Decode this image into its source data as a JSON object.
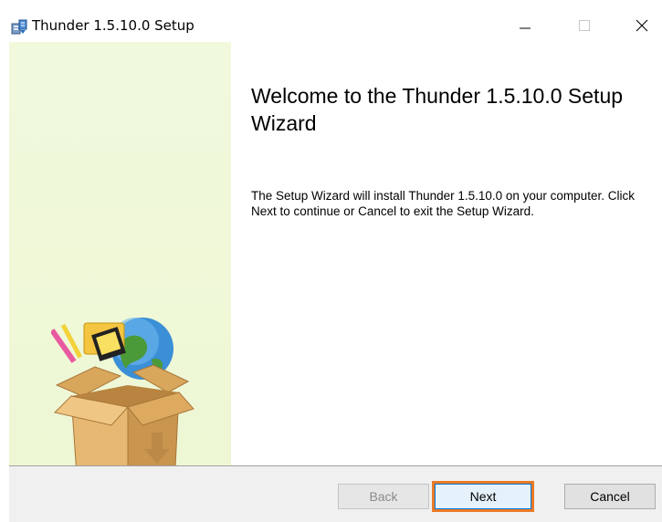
{
  "window": {
    "title": "Thunder 1.5.10.0 Setup",
    "icon": "installer-icon"
  },
  "controls": {
    "minimize_icon": "minimize-icon",
    "maximize_icon": "maximize-icon",
    "close_icon": "close-icon"
  },
  "content": {
    "heading": "Welcome to the Thunder 1.5.10.0 Setup Wizard",
    "description": "The Setup Wizard will install Thunder 1.5.10.0 on your computer. Click Next to continue or Cancel to exit the Setup Wizard."
  },
  "buttons": {
    "back": "Back",
    "next": "Next",
    "cancel": "Cancel"
  },
  "colors": {
    "banner": "#eef7d6",
    "highlight": "#ea7a28",
    "focus": "#0078d7"
  }
}
